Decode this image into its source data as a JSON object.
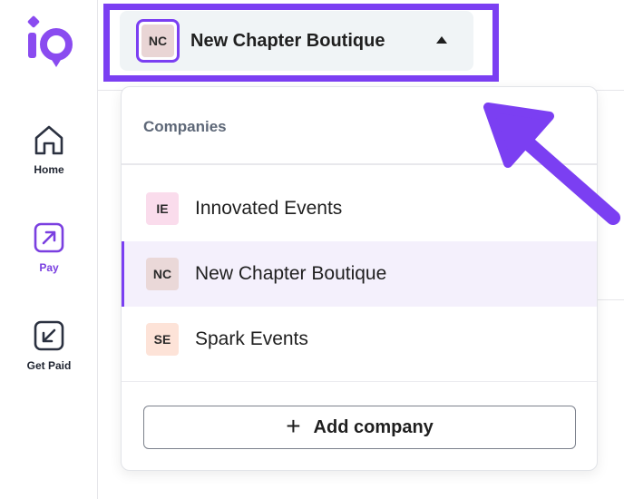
{
  "brand": {
    "logo": "io-logo",
    "accent_color": "#7b3ff2"
  },
  "sidebar": {
    "items": [
      {
        "label": "Home",
        "icon": "home-icon",
        "active": false
      },
      {
        "label": "Pay",
        "icon": "arrow-up-right-icon",
        "active": true
      },
      {
        "label": "Get Paid",
        "icon": "arrow-down-left-icon",
        "active": false
      }
    ]
  },
  "company_switcher": {
    "initials": "NC",
    "name": "New Chapter Boutique",
    "caret": "caret-up-icon"
  },
  "dropdown": {
    "header": "Companies",
    "companies": [
      {
        "initials": "IE",
        "name": "Innovated Events",
        "color": "#fadcec",
        "selected": false
      },
      {
        "initials": "NC",
        "name": "New Chapter Boutique",
        "color": "#ead8d8",
        "selected": true
      },
      {
        "initials": "SE",
        "name": "Spark Events",
        "color": "#fde3d8",
        "selected": false
      }
    ],
    "add_button": {
      "icon": "plus-icon",
      "label": "Add company"
    }
  },
  "annotation": {
    "icon": "pointer-arrow-icon",
    "color": "#7b3ff2"
  }
}
